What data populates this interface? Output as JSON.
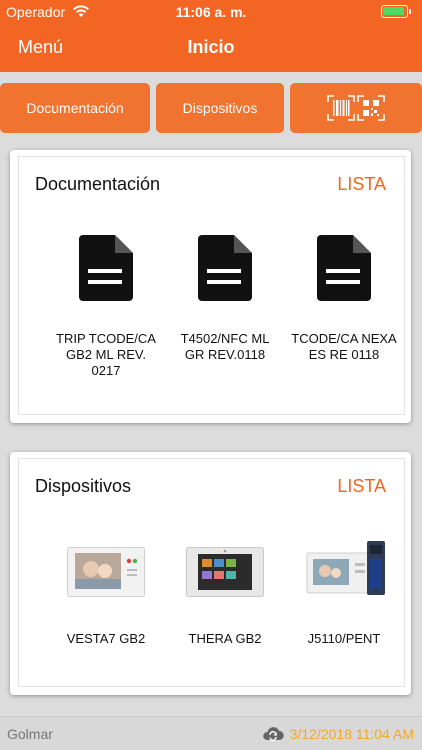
{
  "status_bar": {
    "carrier": "Operador",
    "time": "11:06 a. m."
  },
  "nav": {
    "menu_label": "Menú",
    "title": "Inicio"
  },
  "buttons": {
    "documentacion": "Documentación",
    "dispositivos": "Dispositivos",
    "scan_icon": "barcode-qr-icon"
  },
  "documentacion": {
    "title": "Documentación",
    "lista": "LISTA",
    "items": [
      {
        "label": "TRIP TCODE/CA GB2 ML REV. 0217"
      },
      {
        "label": "T4502/NFC ML GR REV.0118"
      },
      {
        "label": "TCODE/CA NEXA ES RE 0118"
      }
    ]
  },
  "dispositivos": {
    "title": "Dispositivos",
    "lista": "LISTA",
    "items": [
      {
        "label": "VESTA7 GB2"
      },
      {
        "label": "THERA GB2"
      },
      {
        "label": "J5110/PENT"
      }
    ]
  },
  "footer": {
    "brand": "Golmar",
    "sync_icon": "cloud-sync-icon",
    "timestamp": "3/12/2018 11:04 AM"
  },
  "colors": {
    "accent": "#f26522",
    "button": "#f07330",
    "footer_date": "#f5a623",
    "background": "#dcdcdc"
  }
}
